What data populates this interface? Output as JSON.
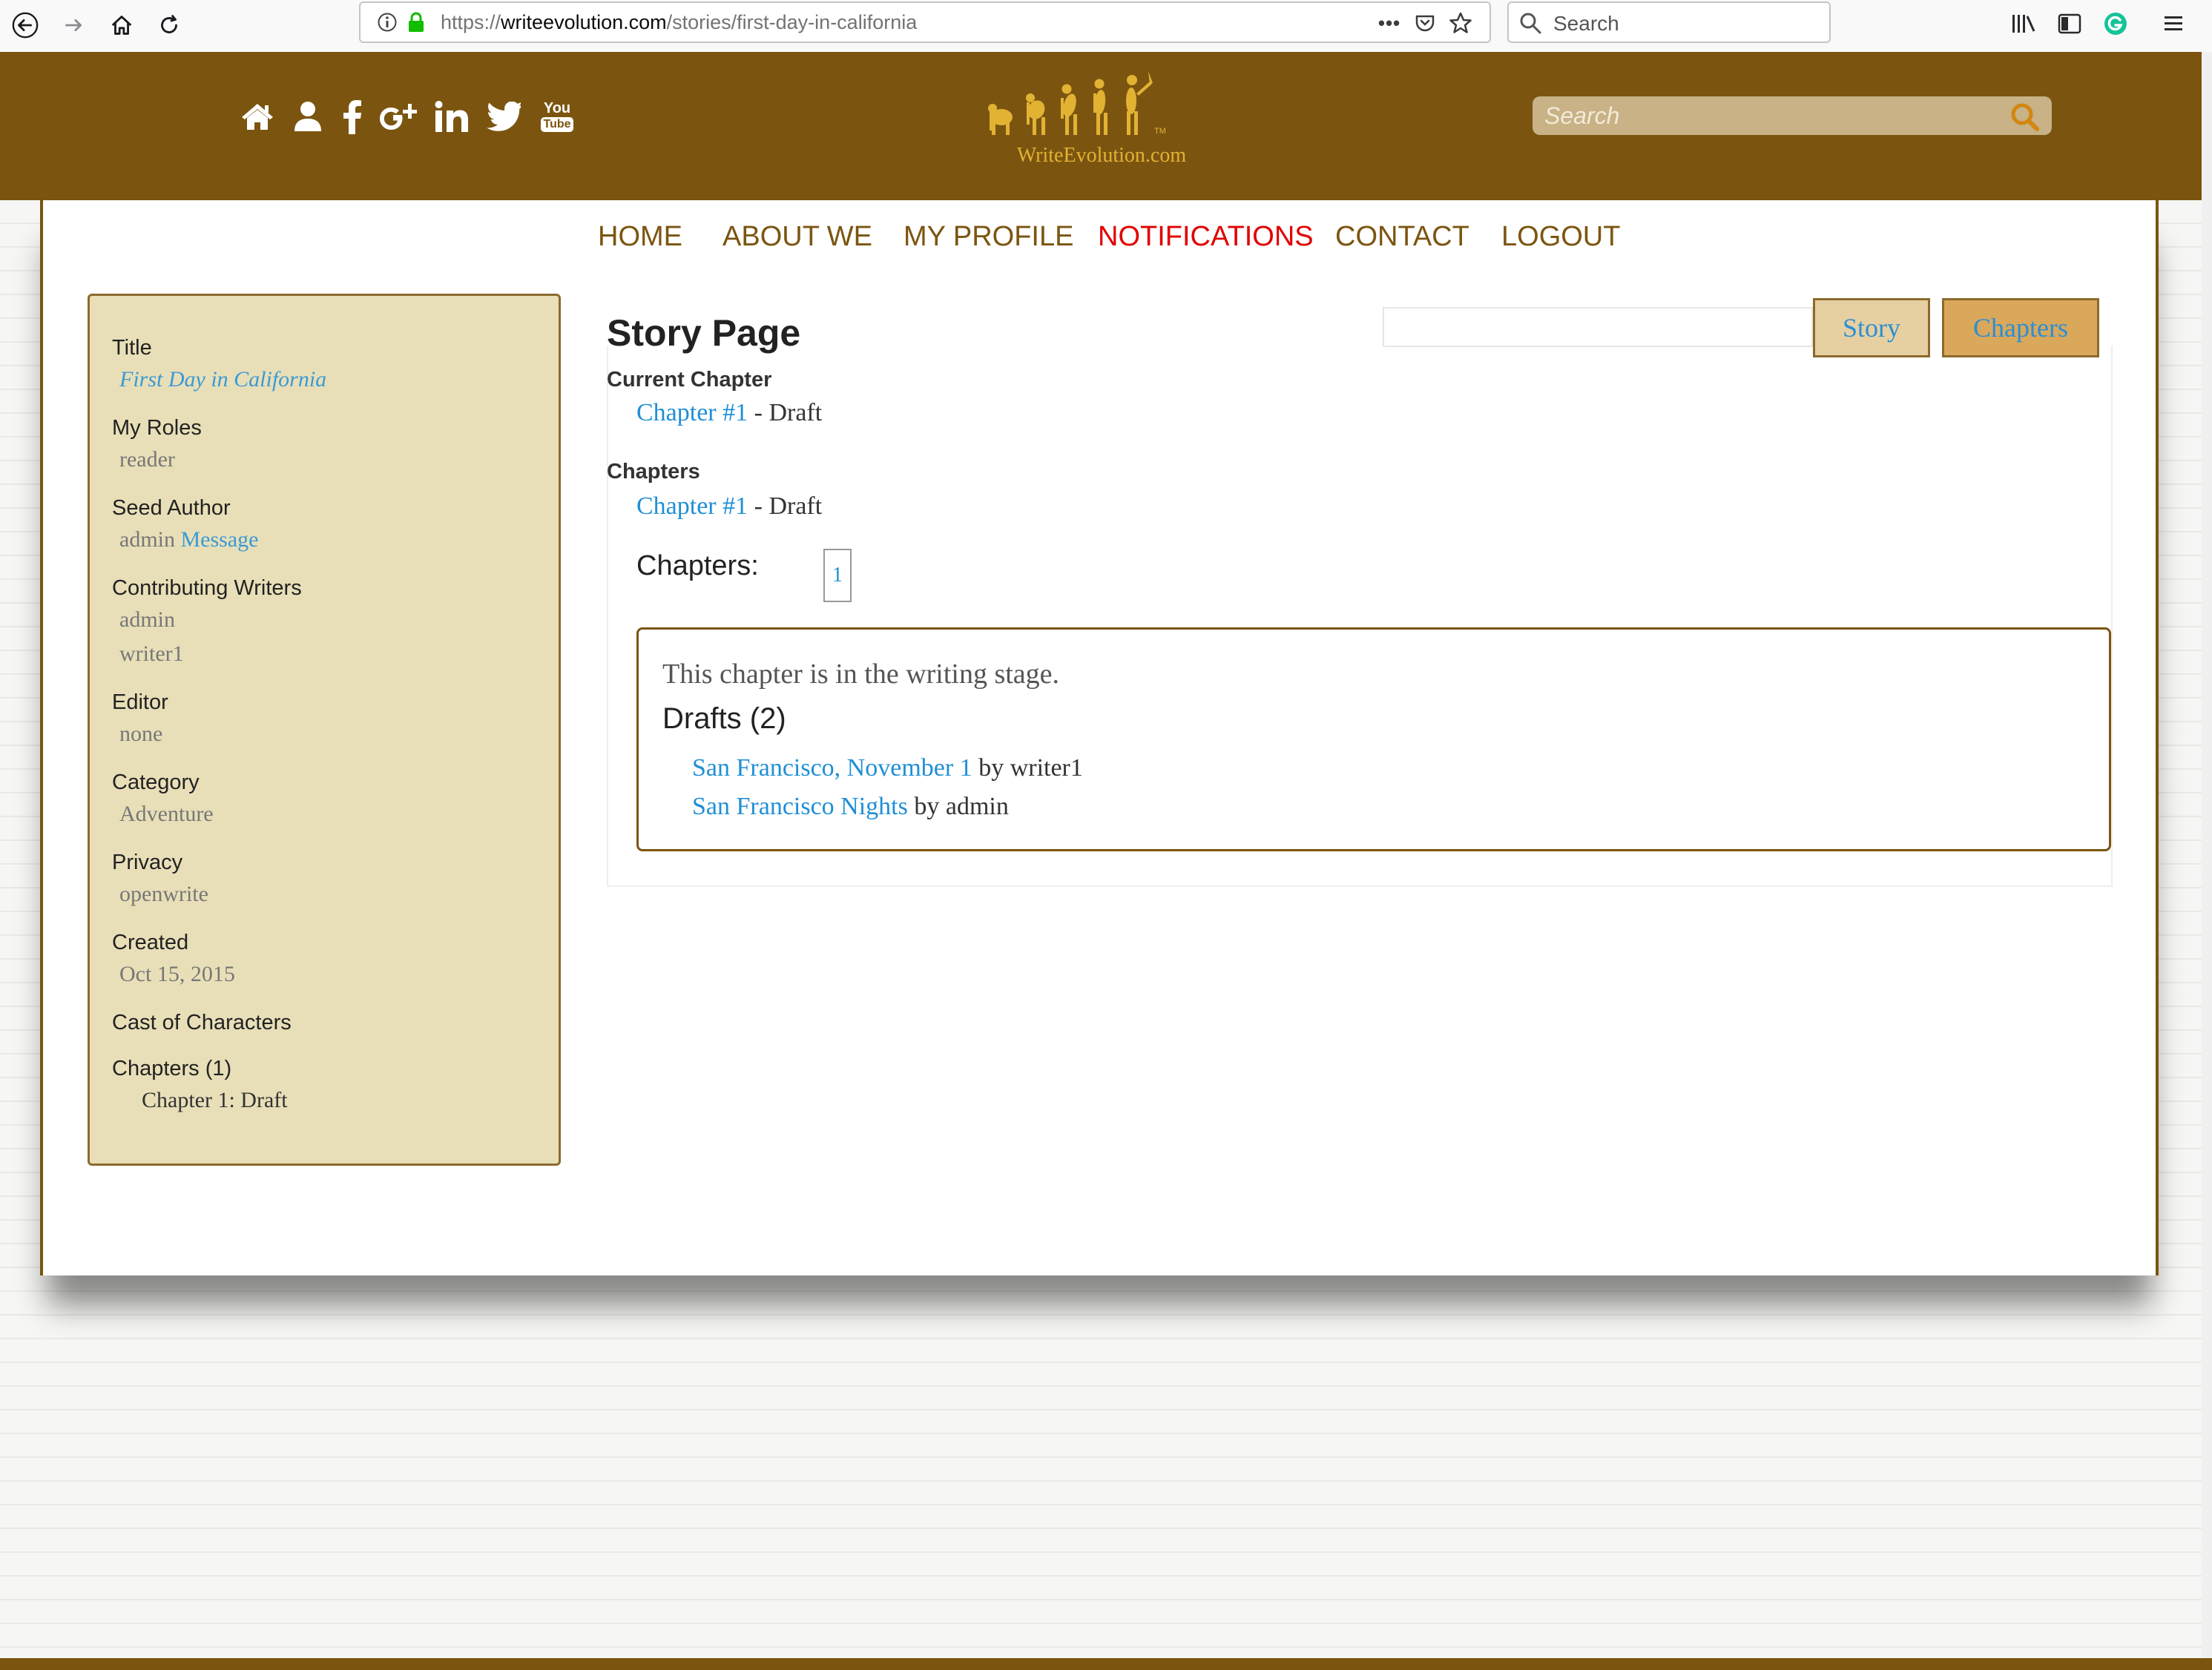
{
  "browser": {
    "url_prefix": "https://",
    "url_domain": "writeevolution.com",
    "url_path": "/stories/first-day-in-california",
    "search_placeholder": "Search",
    "url_more": "•••"
  },
  "header": {
    "social_icons": [
      "home-icon",
      "user-icon",
      "facebook-icon",
      "google-plus-icon",
      "linkedin-icon",
      "twitter-icon",
      "youtube-icon"
    ],
    "logo_text": "WriteEvolution.com",
    "logo_tm": "TM",
    "youtube_text_top": "You",
    "youtube_text_bottom": "Tube",
    "search_placeholder": "Search"
  },
  "nav": {
    "items": [
      "HOME",
      "ABOUT WE",
      "MY PROFILE",
      "NOTIFICATIONS",
      "CONTACT",
      "LOGOUT"
    ],
    "active": "NOTIFICATIONS"
  },
  "sidebar": {
    "title_label": "Title",
    "title_value": "First Day in California",
    "roles_label": "My Roles",
    "roles_value": "reader",
    "seed_label": "Seed Author",
    "seed_value": "admin",
    "seed_link": "Message",
    "contrib_label": "Contributing Writers",
    "contrib_values": [
      "admin",
      "writer1"
    ],
    "editor_label": "Editor",
    "editor_value": "none",
    "category_label": "Category",
    "category_value": "Adventure",
    "privacy_label": "Privacy",
    "privacy_value": "openwrite",
    "created_label": "Created",
    "created_value": "Oct 15, 2015",
    "cast_label": "Cast of Characters",
    "chapters_label": "Chapters (1)",
    "chapters_value": "Chapter 1: Draft"
  },
  "main": {
    "page_title": "Story Page",
    "current_chapter_head": "Current Chapter",
    "current_chapter_link": "Chapter #1",
    "current_chapter_status": " - Draft",
    "chapters_head": "Chapters",
    "chapters_link": "Chapter #1",
    "chapters_status": " - Draft",
    "pager_label": "Chapters:",
    "pager_page": "1",
    "tabs": [
      "Story",
      "Chapters"
    ],
    "stage_text": "This chapter is in the writing stage.",
    "drafts_head": "Drafts (2)",
    "drafts": [
      {
        "title": "San Francisco, November 1",
        "by": " by writer1"
      },
      {
        "title": "San Francisco Nights",
        "by": " by admin"
      }
    ]
  },
  "colors": {
    "header_brown": "#7b5510",
    "sidebar_bg": "#e8dfb8",
    "link_blue": "#1f8fd6",
    "active_red": "#e00000",
    "tab_story_bg": "#e6d0a1",
    "tab_chapters_bg": "#d9a85b"
  }
}
